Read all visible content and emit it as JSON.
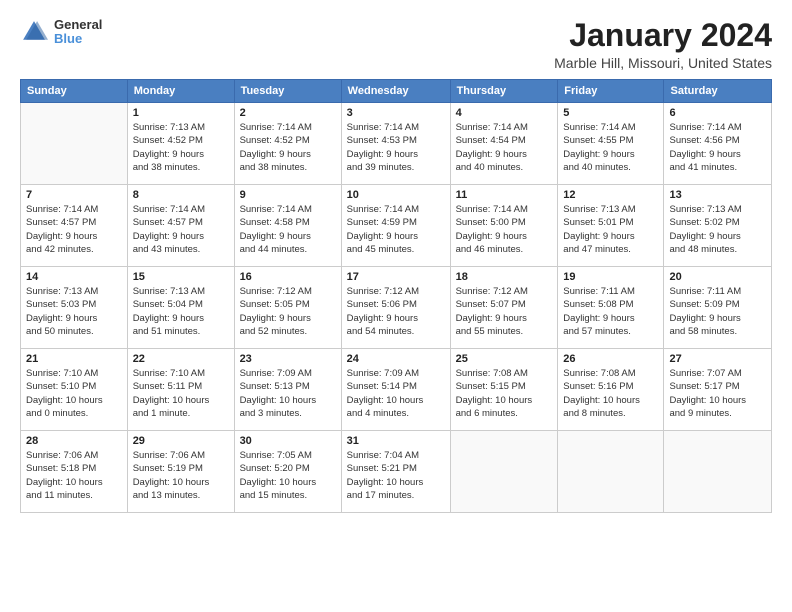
{
  "logo": {
    "general": "General",
    "blue": "Blue"
  },
  "title": "January 2024",
  "subtitle": "Marble Hill, Missouri, United States",
  "days_of_week": [
    "Sunday",
    "Monday",
    "Tuesday",
    "Wednesday",
    "Thursday",
    "Friday",
    "Saturday"
  ],
  "weeks": [
    [
      {
        "day": "",
        "info": ""
      },
      {
        "day": "1",
        "info": "Sunrise: 7:13 AM\nSunset: 4:52 PM\nDaylight: 9 hours\nand 38 minutes."
      },
      {
        "day": "2",
        "info": "Sunrise: 7:14 AM\nSunset: 4:52 PM\nDaylight: 9 hours\nand 38 minutes."
      },
      {
        "day": "3",
        "info": "Sunrise: 7:14 AM\nSunset: 4:53 PM\nDaylight: 9 hours\nand 39 minutes."
      },
      {
        "day": "4",
        "info": "Sunrise: 7:14 AM\nSunset: 4:54 PM\nDaylight: 9 hours\nand 40 minutes."
      },
      {
        "day": "5",
        "info": "Sunrise: 7:14 AM\nSunset: 4:55 PM\nDaylight: 9 hours\nand 40 minutes."
      },
      {
        "day": "6",
        "info": "Sunrise: 7:14 AM\nSunset: 4:56 PM\nDaylight: 9 hours\nand 41 minutes."
      }
    ],
    [
      {
        "day": "7",
        "info": "Sunrise: 7:14 AM\nSunset: 4:57 PM\nDaylight: 9 hours\nand 42 minutes."
      },
      {
        "day": "8",
        "info": "Sunrise: 7:14 AM\nSunset: 4:57 PM\nDaylight: 9 hours\nand 43 minutes."
      },
      {
        "day": "9",
        "info": "Sunrise: 7:14 AM\nSunset: 4:58 PM\nDaylight: 9 hours\nand 44 minutes."
      },
      {
        "day": "10",
        "info": "Sunrise: 7:14 AM\nSunset: 4:59 PM\nDaylight: 9 hours\nand 45 minutes."
      },
      {
        "day": "11",
        "info": "Sunrise: 7:14 AM\nSunset: 5:00 PM\nDaylight: 9 hours\nand 46 minutes."
      },
      {
        "day": "12",
        "info": "Sunrise: 7:13 AM\nSunset: 5:01 PM\nDaylight: 9 hours\nand 47 minutes."
      },
      {
        "day": "13",
        "info": "Sunrise: 7:13 AM\nSunset: 5:02 PM\nDaylight: 9 hours\nand 48 minutes."
      }
    ],
    [
      {
        "day": "14",
        "info": "Sunrise: 7:13 AM\nSunset: 5:03 PM\nDaylight: 9 hours\nand 50 minutes."
      },
      {
        "day": "15",
        "info": "Sunrise: 7:13 AM\nSunset: 5:04 PM\nDaylight: 9 hours\nand 51 minutes."
      },
      {
        "day": "16",
        "info": "Sunrise: 7:12 AM\nSunset: 5:05 PM\nDaylight: 9 hours\nand 52 minutes."
      },
      {
        "day": "17",
        "info": "Sunrise: 7:12 AM\nSunset: 5:06 PM\nDaylight: 9 hours\nand 54 minutes."
      },
      {
        "day": "18",
        "info": "Sunrise: 7:12 AM\nSunset: 5:07 PM\nDaylight: 9 hours\nand 55 minutes."
      },
      {
        "day": "19",
        "info": "Sunrise: 7:11 AM\nSunset: 5:08 PM\nDaylight: 9 hours\nand 57 minutes."
      },
      {
        "day": "20",
        "info": "Sunrise: 7:11 AM\nSunset: 5:09 PM\nDaylight: 9 hours\nand 58 minutes."
      }
    ],
    [
      {
        "day": "21",
        "info": "Sunrise: 7:10 AM\nSunset: 5:10 PM\nDaylight: 10 hours\nand 0 minutes."
      },
      {
        "day": "22",
        "info": "Sunrise: 7:10 AM\nSunset: 5:11 PM\nDaylight: 10 hours\nand 1 minute."
      },
      {
        "day": "23",
        "info": "Sunrise: 7:09 AM\nSunset: 5:13 PM\nDaylight: 10 hours\nand 3 minutes."
      },
      {
        "day": "24",
        "info": "Sunrise: 7:09 AM\nSunset: 5:14 PM\nDaylight: 10 hours\nand 4 minutes."
      },
      {
        "day": "25",
        "info": "Sunrise: 7:08 AM\nSunset: 5:15 PM\nDaylight: 10 hours\nand 6 minutes."
      },
      {
        "day": "26",
        "info": "Sunrise: 7:08 AM\nSunset: 5:16 PM\nDaylight: 10 hours\nand 8 minutes."
      },
      {
        "day": "27",
        "info": "Sunrise: 7:07 AM\nSunset: 5:17 PM\nDaylight: 10 hours\nand 9 minutes."
      }
    ],
    [
      {
        "day": "28",
        "info": "Sunrise: 7:06 AM\nSunset: 5:18 PM\nDaylight: 10 hours\nand 11 minutes."
      },
      {
        "day": "29",
        "info": "Sunrise: 7:06 AM\nSunset: 5:19 PM\nDaylight: 10 hours\nand 13 minutes."
      },
      {
        "day": "30",
        "info": "Sunrise: 7:05 AM\nSunset: 5:20 PM\nDaylight: 10 hours\nand 15 minutes."
      },
      {
        "day": "31",
        "info": "Sunrise: 7:04 AM\nSunset: 5:21 PM\nDaylight: 10 hours\nand 17 minutes."
      },
      {
        "day": "",
        "info": ""
      },
      {
        "day": "",
        "info": ""
      },
      {
        "day": "",
        "info": ""
      }
    ]
  ]
}
